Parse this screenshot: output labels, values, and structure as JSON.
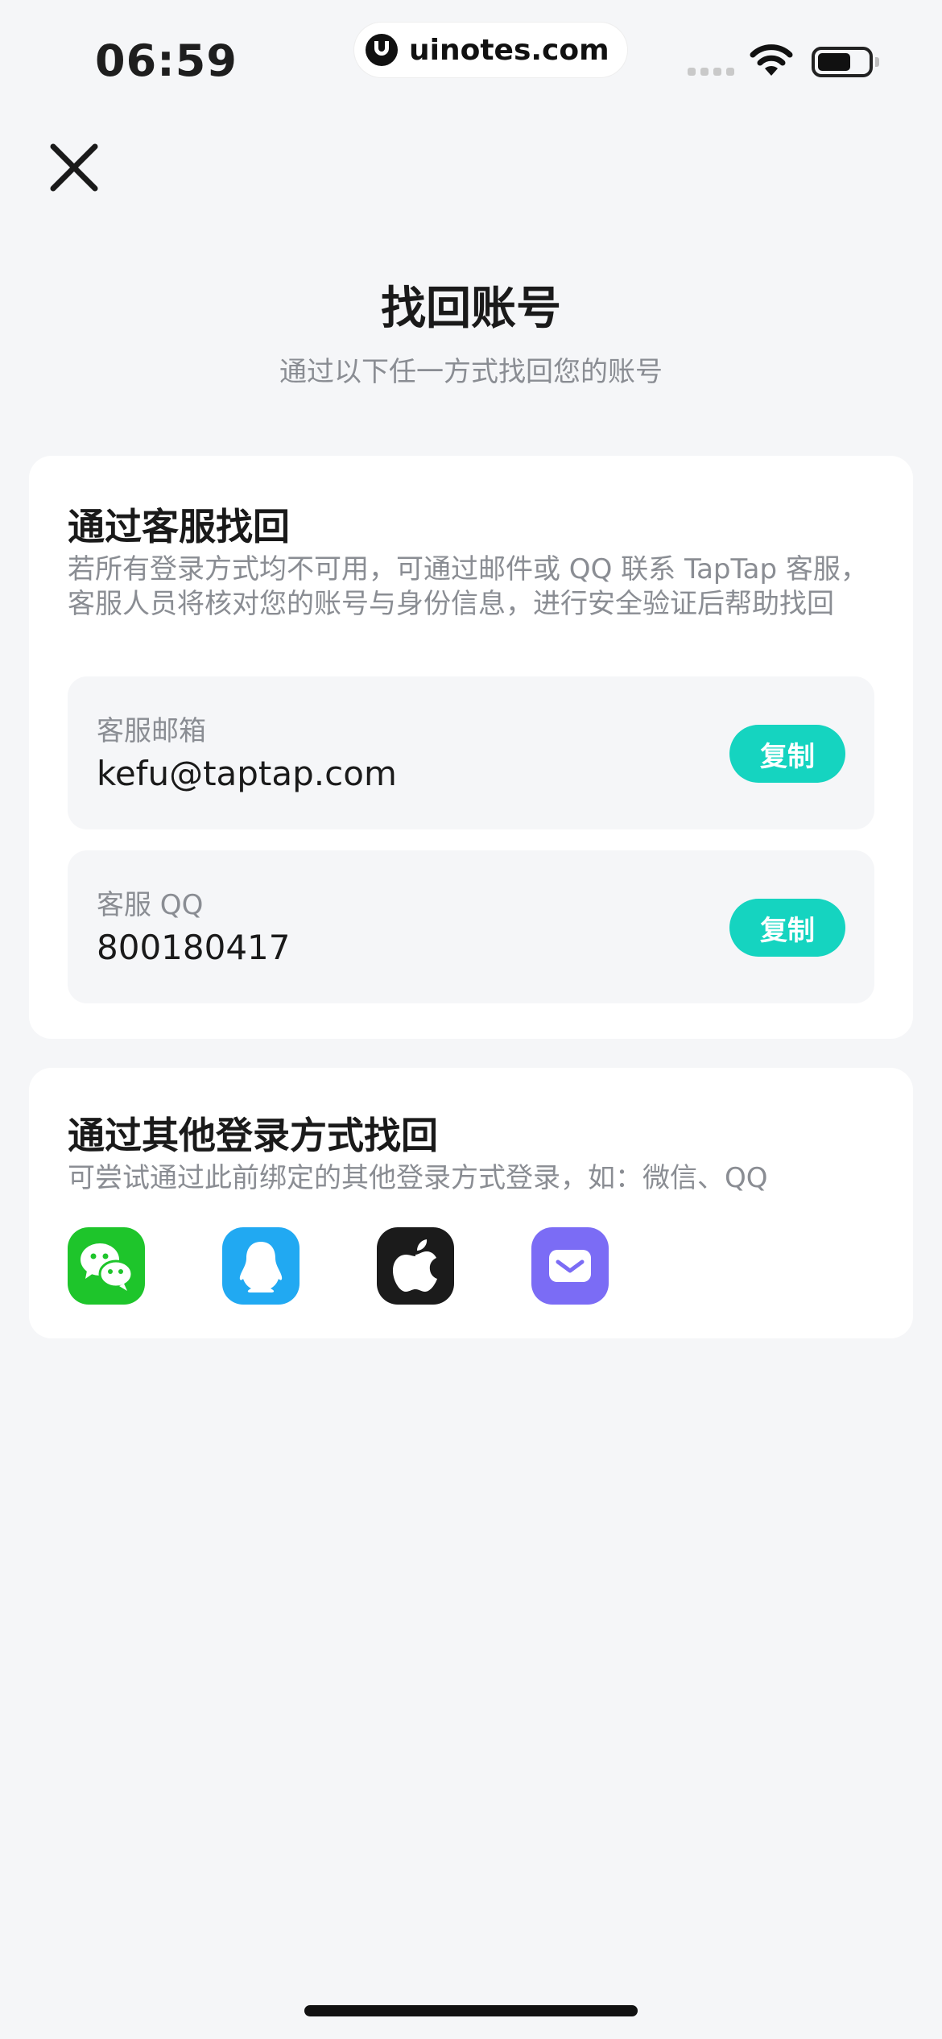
{
  "status_bar": {
    "time": "06:59",
    "watermark": "uinotes.com"
  },
  "header": {
    "close_icon": "close-icon",
    "title": "找回账号",
    "subtitle": "通过以下任一方式找回您的账号"
  },
  "support_section": {
    "title": "通过客服找回",
    "description": "若所有登录方式均不可用，可通过邮件或 QQ 联系 TapTap 客服，客服人员将核对您的账号与身份信息，进行安全验证后帮助找回",
    "email": {
      "label": "客服邮箱",
      "value": "kefu@taptap.com",
      "button_label": "复制"
    },
    "qq": {
      "label": "客服 QQ",
      "value": "800180417",
      "button_label": "复制"
    }
  },
  "other_login_section": {
    "title": "通过其他登录方式找回",
    "description": "可尝试通过此前绑定的其他登录方式登录，如：微信、QQ",
    "methods": [
      {
        "name": "wechat-icon",
        "color": "#1ec52b"
      },
      {
        "name": "qq-icon",
        "color": "#21a9f2"
      },
      {
        "name": "apple-icon",
        "color": "#1b1b1b"
      },
      {
        "name": "mail-icon",
        "color": "#7b6cf5"
      }
    ]
  },
  "colors": {
    "accent": "#15d4c0",
    "background": "#f5f6f8",
    "secondary_text": "#8a8d93"
  }
}
